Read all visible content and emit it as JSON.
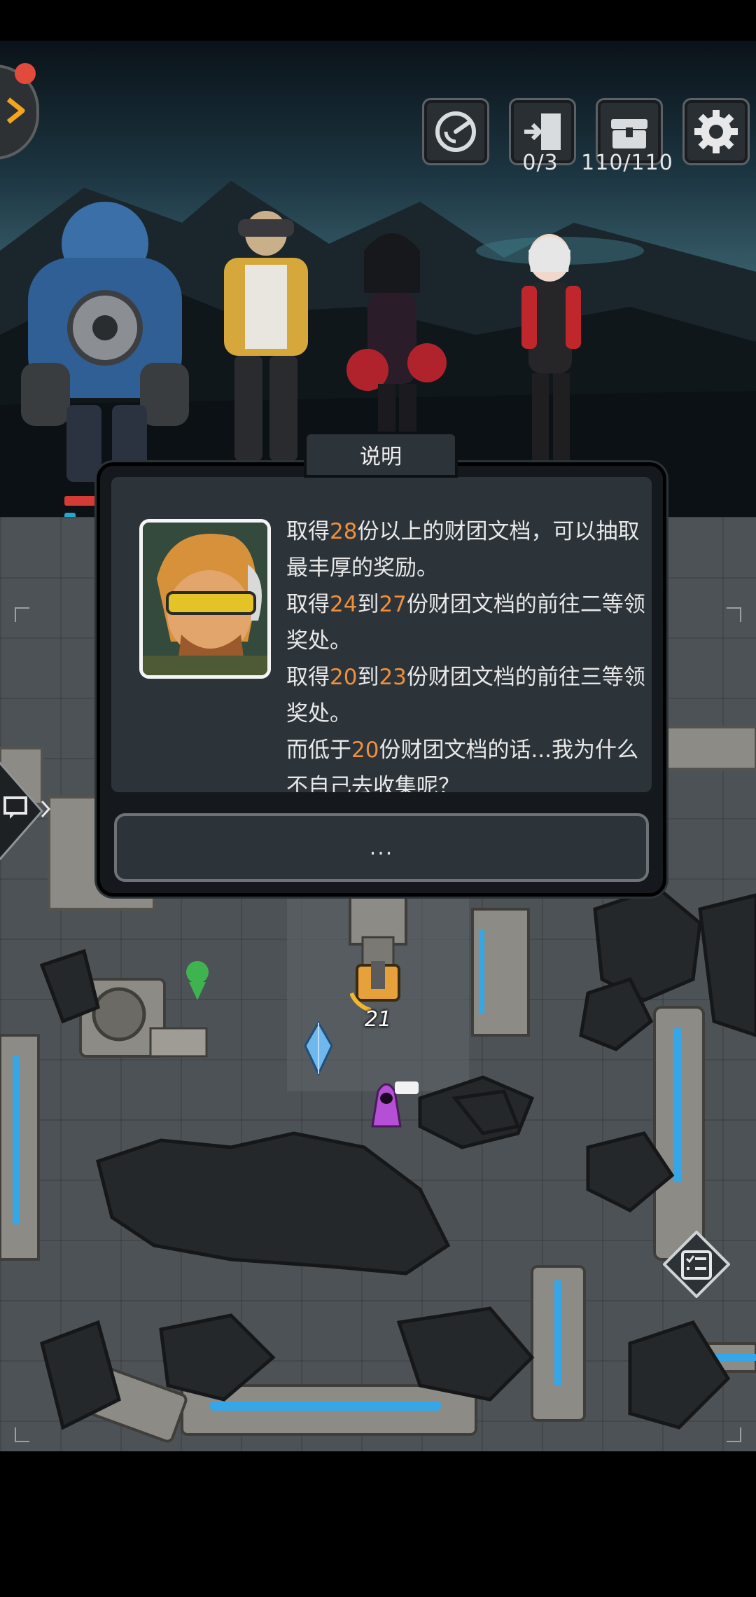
{
  "hud": {
    "exit_count": "0/3",
    "chest_count": "110/110"
  },
  "dialog": {
    "title": "说明",
    "lines": [
      [
        "取得",
        "28",
        "份以上的财团文档，可以抽取最丰厚的奖励。"
      ],
      [
        "取得",
        "24",
        "到",
        "27",
        "份财团文档的前往二等领奖处。"
      ],
      [
        "取得",
        "20",
        "到",
        "23",
        "份财团文档的前往三等领奖处。"
      ],
      [
        "而低于",
        "20",
        "份财团文档的话...我为什么不自己去收集呢？"
      ]
    ],
    "continue_label": "..."
  },
  "map": {
    "timer_value": "21"
  },
  "colors": {
    "highlight": "#f0903c",
    "water": "#35a7e6",
    "notification": "#e24b3c"
  },
  "icons": [
    "menu-arrow-icon",
    "radar-icon",
    "exit-door-icon",
    "chest-icon",
    "gear-icon",
    "chat-icon",
    "quest-list-icon"
  ]
}
